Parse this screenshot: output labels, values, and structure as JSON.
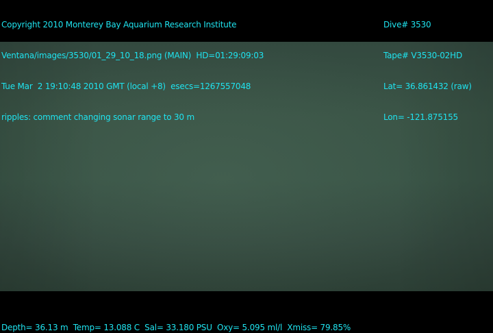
{
  "overlay": {
    "left_lines": [
      "Copyright 2010 Monterey Bay Aquarium Research Institute",
      "Ventana/images/3530/01_29_10_18.png (MAIN)  HD=01:29:09:03",
      "Tue Mar  2 19:10:48 2010 GMT (local +8)  esecs=1267557048",
      "ripples: comment changing sonar range to 30 m"
    ],
    "right_lines": [
      "Dive# 3530",
      "Tape# V3530-02HD",
      "Lat= 36.861432 (raw)",
      "Lon= -121.875155"
    ],
    "footer": "Depth= 36.13 m  Temp= 13.088 C  Sal= 33.180 PSU  Oxy= 5.095 ml/l  Xmiss= 79.85%"
  },
  "colors": {
    "overlay_text": "#1fe3ef",
    "background": "#000000",
    "water": "#3a5446"
  }
}
